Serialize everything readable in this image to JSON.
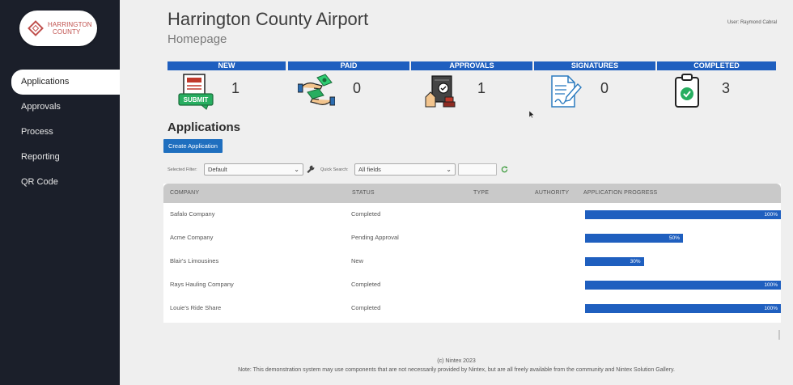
{
  "logo": {
    "line1": "HARRINGTON",
    "line2": "COUNTY"
  },
  "sidebar": {
    "items": [
      {
        "label": "Applications",
        "active": true
      },
      {
        "label": "Approvals",
        "active": false
      },
      {
        "label": "Process",
        "active": false
      },
      {
        "label": "Reporting",
        "active": false
      },
      {
        "label": "QR Code",
        "active": false
      }
    ]
  },
  "header": {
    "title": "Harrington County Airport",
    "subtitle": "Homepage",
    "user": "User: Raymond Cabral"
  },
  "stats": [
    {
      "label": "NEW",
      "value": "1",
      "icon": "submit-form-icon"
    },
    {
      "label": "PAID",
      "value": "0",
      "icon": "money-hand-icon"
    },
    {
      "label": "APPROVALS",
      "value": "1",
      "icon": "approval-stamp-icon"
    },
    {
      "label": "SIGNATURES",
      "value": "0",
      "icon": "signature-document-icon"
    },
    {
      "label": "COMPLETED",
      "value": "3",
      "icon": "clipboard-check-icon"
    }
  ],
  "applications": {
    "title": "Applications",
    "create_button": "Create Application",
    "filter_label": "Selected Filter:",
    "filter_value": "Default",
    "quick_search_label": "Quick Search:",
    "quick_search_value": "All fields",
    "search_text": ""
  },
  "table": {
    "columns": [
      "COMPANY",
      "STATUS",
      "TYPE",
      "AUTHORITY",
      "APPLICATION PROGRESS"
    ],
    "rows": [
      {
        "company": "Safalo Company",
        "status": "Completed",
        "type": "",
        "authority": "",
        "progress": 100,
        "progress_label": "100%"
      },
      {
        "company": "Acme Company",
        "status": "Pending Approval",
        "type": "",
        "authority": "",
        "progress": 50,
        "progress_label": "50%"
      },
      {
        "company": "Blair's Limousines",
        "status": "New",
        "type": "",
        "authority": "",
        "progress": 30,
        "progress_label": "30%"
      },
      {
        "company": "Rays Hauling Company",
        "status": "Completed",
        "type": "",
        "authority": "",
        "progress": 100,
        "progress_label": "100%"
      },
      {
        "company": "Louie's Ride Share",
        "status": "Completed",
        "type": "",
        "authority": "",
        "progress": 100,
        "progress_label": "100%"
      }
    ]
  },
  "footer": {
    "copyright": "(c) Nintex 2023",
    "note": "Note: This demonstration system may use components that are not necessarily provided by Nintex, but are all freely available from the community and Nintex Solution Gallery."
  },
  "colors": {
    "sidebar_bg": "#1b1f2a",
    "accent_blue": "#1f5fbf",
    "logo_red": "#c0504d",
    "page_bg": "#efefef"
  }
}
